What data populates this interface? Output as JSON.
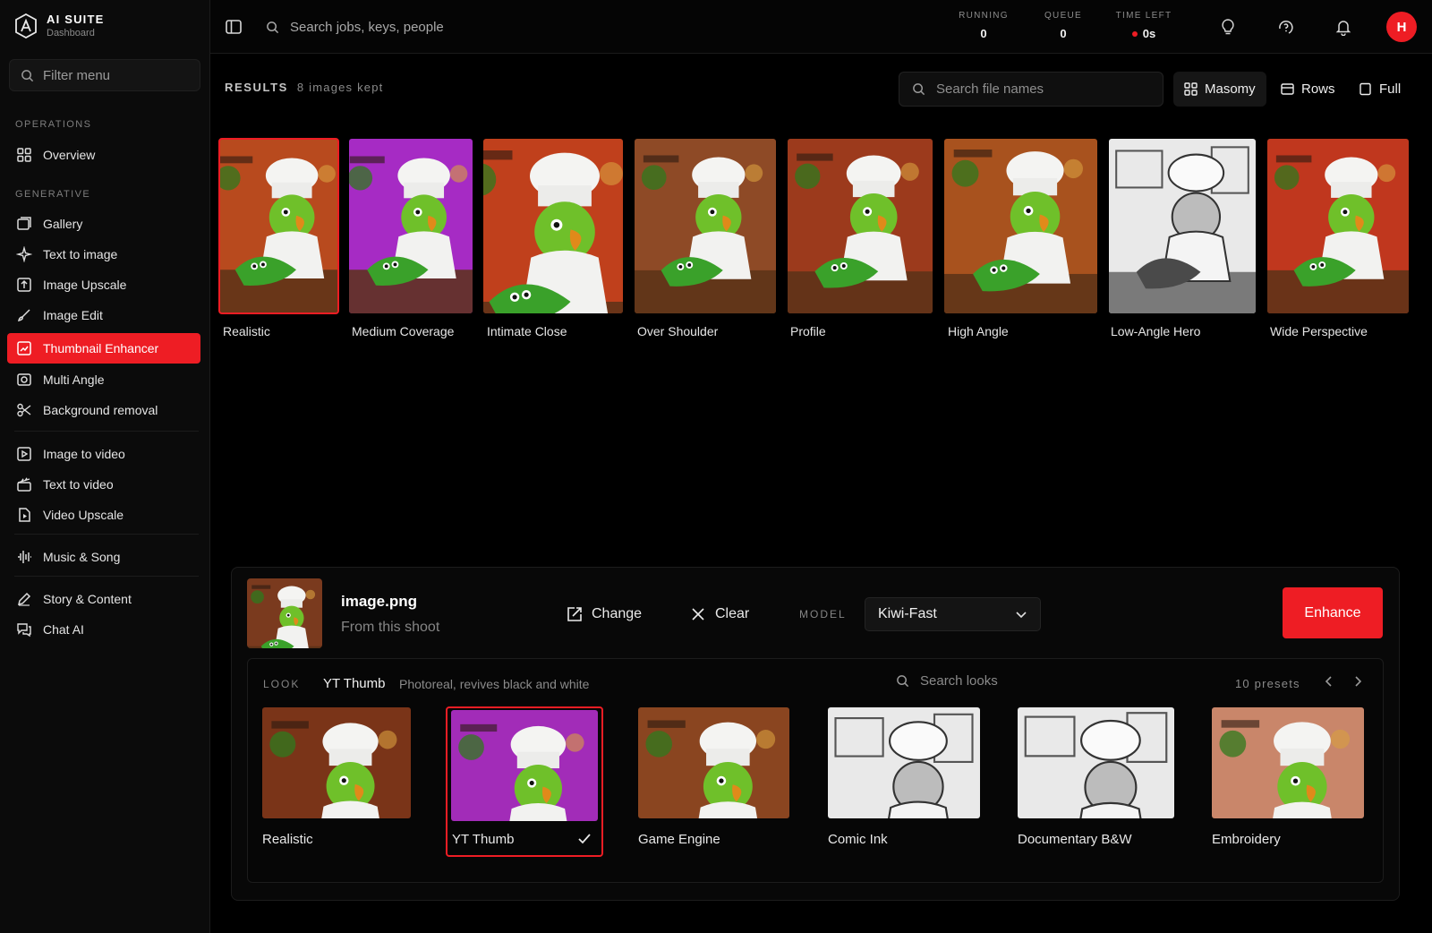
{
  "brand": {
    "title": "AI SUITE",
    "subtitle": "Dashboard"
  },
  "sidebar": {
    "filter_placeholder": "Filter menu",
    "sections": {
      "operations": "OPERATIONS",
      "generative": "GENERATIVE"
    },
    "items": [
      {
        "label": "Overview",
        "icon": "grid-icon"
      },
      {
        "label": "Gallery",
        "icon": "gallery-icon"
      },
      {
        "label": "Text to image",
        "icon": "sparkle-icon"
      },
      {
        "label": "Image Upscale",
        "icon": "upscale-icon"
      },
      {
        "label": "Image Edit",
        "icon": "brush-icon"
      },
      {
        "label": "Thumbnail Enhancer",
        "icon": "enhance-icon",
        "active": true
      },
      {
        "label": "Multi Angle",
        "icon": "camera-icon"
      },
      {
        "label": "Background removal",
        "icon": "scissors-icon"
      },
      {
        "label": "Image to video",
        "icon": "image-video-icon"
      },
      {
        "label": "Text to video",
        "icon": "clapper-icon"
      },
      {
        "label": "Video Upscale",
        "icon": "video-upscale-icon"
      },
      {
        "label": "Music & Song",
        "icon": "waveform-icon"
      },
      {
        "label": "Story & Content",
        "icon": "pen-icon"
      },
      {
        "label": "Chat AI",
        "icon": "chat-icon"
      }
    ]
  },
  "topbar": {
    "search_placeholder": "Search jobs, keys, people",
    "stats": {
      "running": {
        "label": "RUNNING",
        "value": "0"
      },
      "queue": {
        "label": "QUEUE",
        "value": "0"
      },
      "time_left": {
        "label": "TIME LEFT",
        "value": "0s"
      }
    },
    "avatar_initial": "H"
  },
  "results": {
    "label": "RESULTS",
    "count": "8 images kept",
    "search_placeholder": "Search file names",
    "views": [
      "Masomy",
      "Rows",
      "Full"
    ],
    "images": [
      "Realistic",
      "Medium Coverage",
      "Intimate Close",
      "Over Shoulder",
      "Profile",
      "High Angle",
      "Low-Angle Hero",
      "Wide Perspective"
    ]
  },
  "enhancer": {
    "file_name": "image.png",
    "file_source": "From this shoot",
    "change_label": "Change",
    "clear_label": "Clear",
    "model_label": "MODEL",
    "model_value": "Kiwi-Fast",
    "enhance_label": "Enhance",
    "look_label": "LOOK",
    "look_name": "YT Thumb",
    "look_desc": "Photoreal, revives black and white",
    "look_search_placeholder": "Search looks",
    "presets_count": "10 presets",
    "presets": [
      "Realistic",
      "YT Thumb",
      "Game Engine",
      "Comic Ink",
      "Documentary B&W",
      "Embroidery"
    ],
    "selected_preset": "YT Thumb"
  },
  "colors": {
    "accent": "#ee1d24",
    "background": "#000000",
    "sidebar": "#0b0b0b"
  }
}
